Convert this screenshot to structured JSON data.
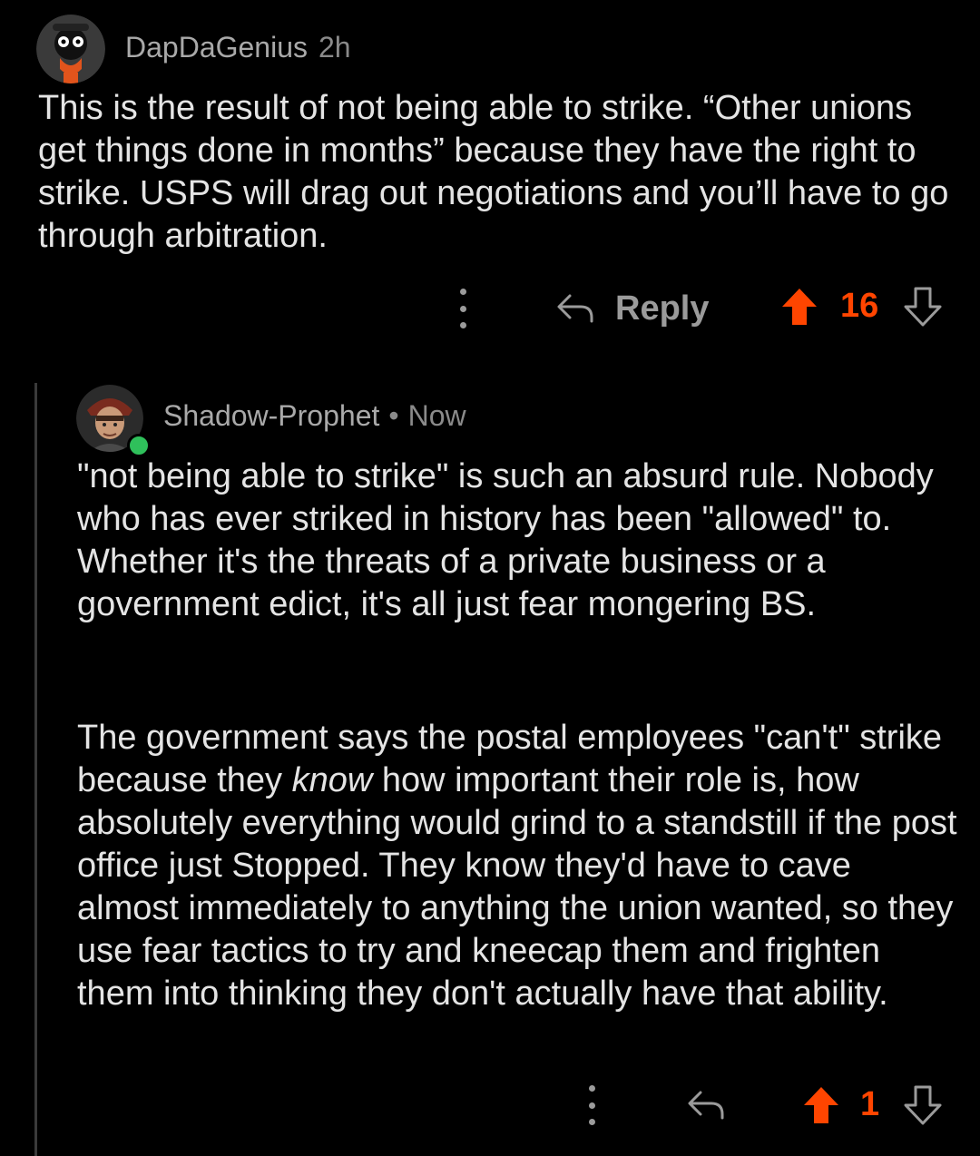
{
  "comments": [
    {
      "author": "DapDaGenius",
      "time": "2h",
      "body": "This is the result of not being able to strike. “Other unions get things done in months” because they have the right to strike. USPS will drag out negotiations and you’ll have to go through arbitration.",
      "reply_label": "Reply",
      "votes": "16"
    },
    {
      "author": "Shadow-Prophet",
      "separator": "•",
      "time": "Now",
      "online": true,
      "paragraph1": "\"not being able to strike\" is such an absurd rule. Nobody who has ever striked in history has been \"allowed\" to. Whether it's the threats of a private business or a government edict, it's all just fear mongering BS.",
      "paragraph2_before": "The government says the postal employees \"can't\" strike because they ",
      "paragraph2_emphasis": "know",
      "paragraph2_after": " how important their role is, how absolutely everything would grind to a standstill if the post office just Stopped. They know they'd have to cave almost immediately to anything the union wanted, so they use fear tactics to try and kneecap them and frighten them into thinking they don't actually have that ability.",
      "votes": "1"
    }
  ],
  "icons": {
    "more": "more-vertical-icon",
    "reply": "reply-arrow-icon",
    "upvote": "upvote-arrow-icon",
    "downvote": "downvote-arrow-icon"
  },
  "colors": {
    "background": "#000000",
    "text": "#e4e4e4",
    "meta": "#8a8a8a",
    "upvote_active": "#ff4500",
    "online": "#2fc05b"
  }
}
